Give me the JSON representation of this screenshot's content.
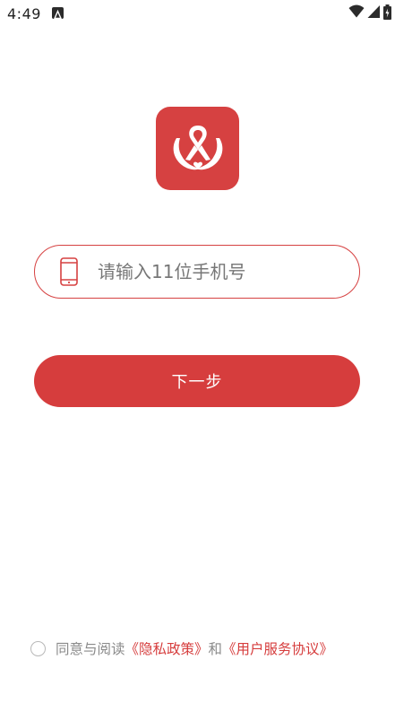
{
  "status_bar": {
    "time": "4:49",
    "icons": [
      "notification-icon",
      "wifi-icon",
      "signal-icon",
      "battery-icon"
    ]
  },
  "logo": {
    "icon": "ribbon-hands-logo",
    "background_color": "#d64141"
  },
  "phone_field": {
    "icon": "mobile-phone-icon",
    "placeholder": "请输入11位手机号",
    "value": ""
  },
  "next_button": {
    "label": "下一步"
  },
  "agreement": {
    "checked": false,
    "prefix": "同意与阅读",
    "privacy_link": "《隐私政策》",
    "conjunction": "和",
    "service_link": "《用户服务协议》"
  },
  "colors": {
    "accent": "#d63d3d",
    "text_muted": "#8a8a8a"
  }
}
